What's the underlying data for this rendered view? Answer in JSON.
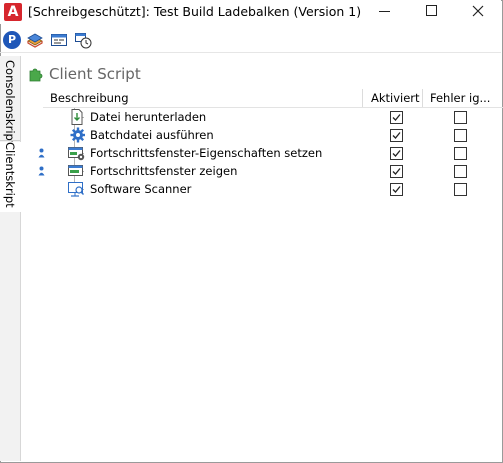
{
  "window": {
    "title": "[Schreibgeschützt]: Test Build Ladebalken (Version 1)",
    "app_icon_letter": "A",
    "app_icon_color": "#d6262d"
  },
  "toolbar": {
    "p_label": "P",
    "icons": [
      "publish-icon",
      "deploy-icon",
      "console-window-icon",
      "schedule-icon"
    ]
  },
  "side_tabs": [
    {
      "label": "Consolenskript",
      "selected": false
    },
    {
      "label": "Clientskript",
      "selected": true
    }
  ],
  "section": {
    "title": "Client Script",
    "icon": "puzzle-icon",
    "icon_color": "#4aa84a"
  },
  "grid": {
    "columns": {
      "description": "Beschreibung",
      "enabled": "Aktiviert",
      "ignore_errors": "Fehler ig..."
    },
    "rows": [
      {
        "label": "Datei herunterladen",
        "icon": "download-file-icon",
        "aktiviert": true,
        "fehler": false,
        "user_marker": false
      },
      {
        "label": "Batchdatei ausführen",
        "icon": "gear-icon",
        "aktiviert": true,
        "fehler": false,
        "user_marker": false
      },
      {
        "label": "Fortschrittsfenster-Eigenschaften setzen",
        "icon": "window-settings-icon",
        "aktiviert": true,
        "fehler": false,
        "user_marker": true
      },
      {
        "label": "Fortschrittsfenster zeigen",
        "icon": "window-show-icon",
        "aktiviert": true,
        "fehler": false,
        "user_marker": true
      },
      {
        "label": "Software Scanner",
        "icon": "scanner-icon",
        "aktiviert": true,
        "fehler": false,
        "user_marker": false
      }
    ]
  }
}
